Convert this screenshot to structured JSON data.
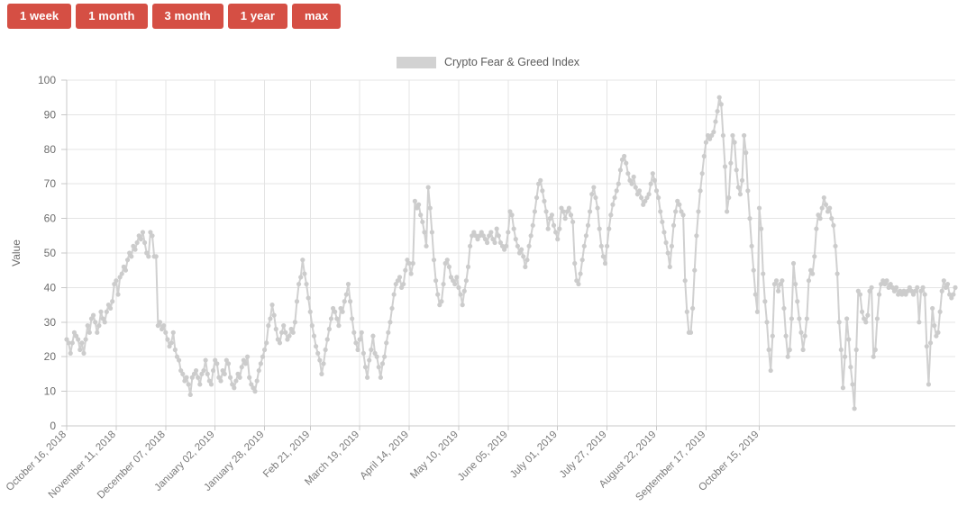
{
  "range_buttons": [
    {
      "label": "1 week",
      "name": "range-1-week"
    },
    {
      "label": "1 month",
      "name": "range-1-month"
    },
    {
      "label": "3 month",
      "name": "range-3-month"
    },
    {
      "label": "1 year",
      "name": "range-1-year"
    },
    {
      "label": "max",
      "name": "range-max"
    }
  ],
  "colors": {
    "button_bg": "#d54f44",
    "button_text": "#ffffff",
    "series": "#d0d0d0",
    "grid": "#e4e4e4",
    "axis": "#c8c8c8",
    "tick_text": "#6d6d6d"
  },
  "legend": {
    "position": "top-center",
    "entries": [
      {
        "label": "Crypto Fear & Greed Index",
        "color": "#d2d2d2"
      }
    ]
  },
  "chart_data": {
    "type": "line",
    "title": "",
    "subtitle": "",
    "xlabel": "",
    "ylabel": "Value",
    "ylim": [
      0,
      100
    ],
    "yticks": [
      0,
      10,
      20,
      30,
      40,
      50,
      60,
      70,
      80,
      90,
      100
    ],
    "grid": true,
    "legend_position": "top-center",
    "xtick_labels": [
      "October 16, 2018",
      "November 11, 2018",
      "December 07, 2018",
      "January 02, 2019",
      "January 28, 2019",
      "Feb 21, 2019",
      "March 19, 2019",
      "April 14, 2019",
      "May 10, 2019",
      "June 05, 2019",
      "July 01, 2019",
      "July 27, 2019",
      "August 22, 2019",
      "September 17, 2019",
      "October 15, 2019"
    ],
    "xtick_indices": [
      0,
      26,
      52,
      78,
      104,
      128,
      154,
      180,
      206,
      232,
      258,
      284,
      310,
      336,
      364
    ],
    "series": [
      {
        "name": "Crypto Fear & Greed Index",
        "color": "#d0d0d0",
        "marker": "circle",
        "values": [
          25,
          24,
          21,
          24,
          27,
          26,
          25,
          22,
          24,
          21,
          25,
          29,
          27,
          31,
          32,
          30,
          27,
          29,
          33,
          31,
          30,
          33,
          35,
          34,
          36,
          41,
          42,
          38,
          43,
          44,
          46,
          45,
          48,
          50,
          49,
          52,
          51,
          53,
          55,
          54,
          56,
          53,
          50,
          49,
          56,
          55,
          49,
          49,
          29,
          30,
          28,
          29,
          27,
          25,
          23,
          24,
          27,
          22,
          20,
          19,
          16,
          15,
          13,
          14,
          12,
          9,
          14,
          15,
          16,
          14,
          12,
          15,
          16,
          19,
          15,
          13,
          12,
          16,
          19,
          18,
          14,
          13,
          16,
          15,
          19,
          18,
          14,
          12,
          11,
          13,
          15,
          14,
          17,
          19,
          18,
          20,
          14,
          12,
          11,
          10,
          13,
          16,
          18,
          20,
          22,
          24,
          29,
          31,
          35,
          32,
          28,
          25,
          24,
          27,
          29,
          27,
          25,
          26,
          28,
          27,
          30,
          36,
          41,
          43,
          48,
          44,
          41,
          37,
          33,
          29,
          26,
          23,
          21,
          19,
          15,
          18,
          22,
          25,
          28,
          31,
          34,
          33,
          31,
          29,
          34,
          33,
          36,
          38,
          41,
          36,
          31,
          27,
          24,
          22,
          25,
          27,
          21,
          17,
          14,
          19,
          22,
          26,
          21,
          20,
          17,
          14,
          18,
          20,
          24,
          27,
          30,
          34,
          38,
          41,
          42,
          43,
          40,
          41,
          45,
          48,
          47,
          44,
          47,
          65,
          63,
          64,
          61,
          59,
          56,
          52,
          69,
          63,
          56,
          48,
          42,
          38,
          35,
          36,
          41,
          47,
          48,
          46,
          43,
          42,
          41,
          43,
          40,
          38,
          35,
          39,
          42,
          46,
          52,
          55,
          56,
          55,
          54,
          55,
          56,
          55,
          54,
          53,
          55,
          56,
          54,
          53,
          57,
          55,
          53,
          52,
          51,
          52,
          56,
          62,
          61,
          57,
          54,
          52,
          50,
          51,
          49,
          46,
          48,
          52,
          55,
          58,
          62,
          66,
          70,
          71,
          68,
          65,
          62,
          57,
          60,
          61,
          58,
          56,
          54,
          57,
          63,
          62,
          60,
          62,
          63,
          61,
          59,
          47,
          42,
          41,
          44,
          48,
          52,
          55,
          58,
          62,
          67,
          69,
          66,
          63,
          57,
          52,
          49,
          47,
          52,
          57,
          61,
          64,
          66,
          68,
          70,
          74,
          77,
          78,
          76,
          73,
          71,
          70,
          72,
          69,
          67,
          68,
          66,
          64,
          65,
          66,
          67,
          70,
          73,
          71,
          68,
          66,
          62,
          59,
          56,
          53,
          50,
          46,
          52,
          58,
          62,
          65,
          64,
          62,
          61,
          42,
          33,
          27,
          27,
          34,
          45,
          55,
          62,
          68,
          73,
          78,
          82,
          84,
          83,
          84,
          85,
          88,
          91,
          95,
          93,
          84,
          75,
          62,
          66,
          76,
          84,
          82,
          74,
          69,
          67,
          71,
          84,
          79,
          68,
          60,
          52,
          45,
          38,
          33,
          63,
          57,
          44,
          36,
          30,
          22,
          16,
          26,
          41,
          42,
          39,
          41,
          42,
          34,
          26,
          20,
          22,
          31,
          47,
          41,
          36,
          31,
          27,
          22,
          26,
          31,
          42,
          45,
          44,
          49,
          57,
          61,
          60,
          63,
          66,
          64,
          62,
          63,
          60,
          58,
          52,
          44,
          30,
          22,
          11,
          20,
          31,
          25,
          17,
          12,
          5,
          22,
          39,
          38,
          33,
          31,
          30,
          32,
          39,
          40,
          20,
          22,
          31,
          38,
          41,
          42,
          41,
          42,
          40,
          41,
          40,
          39,
          40,
          38,
          39,
          38,
          39,
          38,
          39,
          40,
          39,
          38,
          39,
          40,
          30,
          39,
          40,
          38,
          23,
          12,
          24,
          34,
          29,
          26,
          27,
          33,
          39,
          42,
          40,
          41,
          38,
          37,
          38,
          40
        ]
      }
    ]
  }
}
